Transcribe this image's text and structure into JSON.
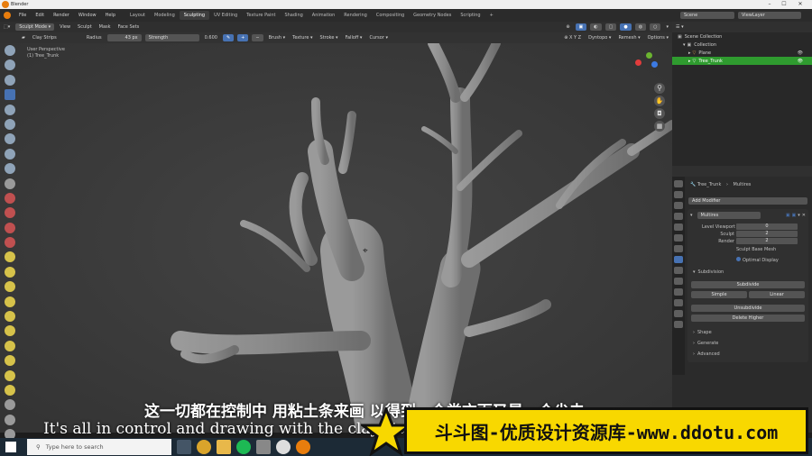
{
  "window": {
    "title": "Blender"
  },
  "menu": [
    "File",
    "Edit",
    "Render",
    "Window",
    "Help"
  ],
  "workspaces": [
    "Layout",
    "Modeling",
    "Sculpting",
    "UV Editing",
    "Texture Paint",
    "Shading",
    "Animation",
    "Rendering",
    "Compositing",
    "Geometry Nodes",
    "Scripting"
  ],
  "active_workspace": "Sculpting",
  "scene": {
    "label": "Scene",
    "view_layer": "ViewLayer"
  },
  "view_header": {
    "mode": "Sculpt Mode",
    "menus": [
      "View",
      "Sculpt",
      "Mask",
      "Face Sets"
    ],
    "dyntopo": "Dyntopo",
    "remesh": "Remesh",
    "options": "Options"
  },
  "tool_settings": {
    "brush": "Clay Strips",
    "radius_label": "Radius",
    "radius_value": "43 px",
    "strength_label": "Strength",
    "strength_value": "0.600",
    "menus": [
      "Brush",
      "Texture",
      "Stroke",
      "Falloff",
      "Cursor"
    ]
  },
  "viewport": {
    "perspective": "User Perspective",
    "object": "(1) Tree_Trunk"
  },
  "outliner": {
    "rows": [
      {
        "label": "Scene Collection",
        "indent": 0
      },
      {
        "label": "Collection",
        "indent": 1
      },
      {
        "label": "Plane",
        "indent": 2
      },
      {
        "label": "Tree_Trunk",
        "indent": 2,
        "selected": true
      }
    ]
  },
  "properties": {
    "object_name": "Tree_Trunk",
    "modifier_tab": "Multires",
    "add_modifier": "Add Modifier",
    "modifier_name": "Multires",
    "level_viewport_label": "Level Viewport",
    "level_viewport": "0",
    "sculpt_label": "Sculpt",
    "sculpt": "2",
    "render_label": "Render",
    "render": "2",
    "sculpt_base_mesh": "Sculpt Base Mesh",
    "optimal_display": "Optimal Display",
    "subdivision_header": "Subdivision",
    "subdivide": "Subdivide",
    "simple": "Simple",
    "linear": "Linear",
    "unsubdivide": "Unsubdivide",
    "delete_higher": "Delete Higher",
    "sections": [
      "Shape",
      "Generate",
      "Advanced"
    ]
  },
  "taskbar": {
    "search_placeholder": "Type here to search"
  },
  "subtitles": {
    "chinese": "这一切都在控制中 用粘土条来画 以得到一个类方面又是一个尖去",
    "english": "It's all in control and drawing with the clay strips"
  },
  "watermark": {
    "text": "斗斗图-优质设计资源库-www.ddotu.com"
  },
  "colors": {
    "accent_blue": "#4772b3",
    "selection_green": "#2f9b2f",
    "watermark_yellow": "#f8d800",
    "tree_grey": "#8a8a8a"
  }
}
